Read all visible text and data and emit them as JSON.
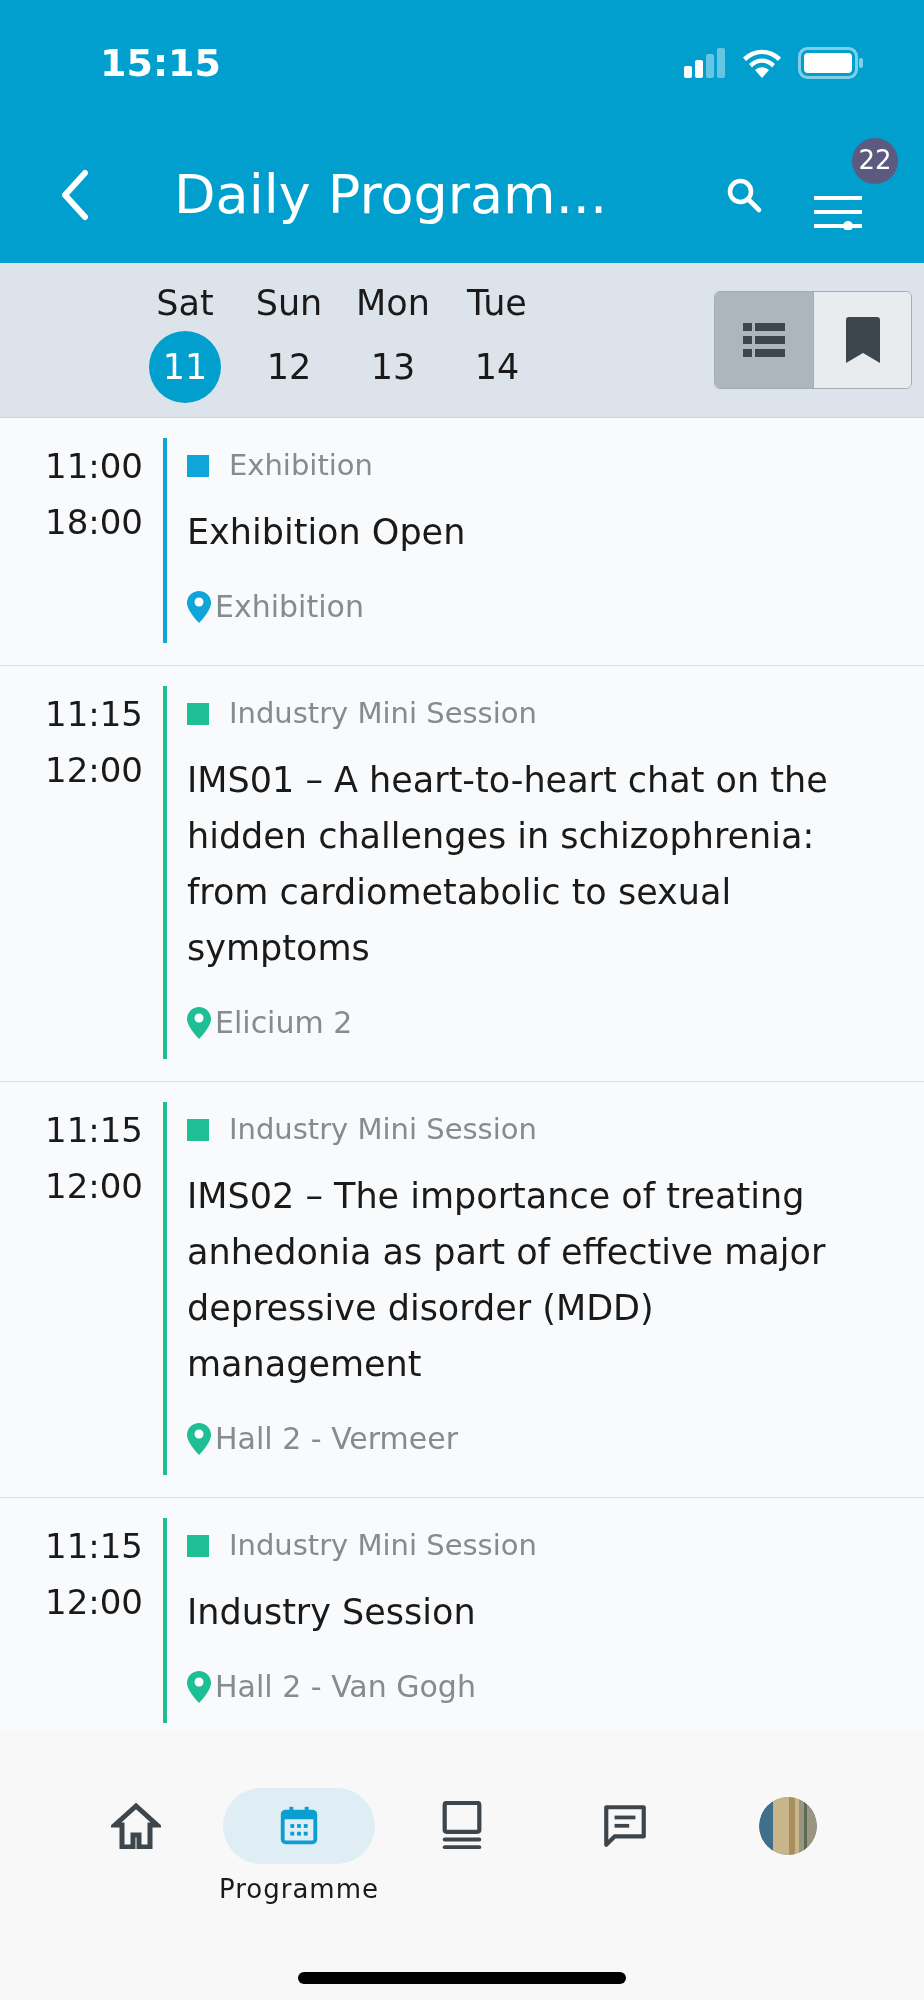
{
  "status_bar": {
    "time": "15:15"
  },
  "header": {
    "title": "Daily Program...",
    "filter_badge": "22"
  },
  "days": [
    {
      "weekday": "Sat",
      "date": "11",
      "selected": true
    },
    {
      "weekday": "Sun",
      "date": "12",
      "selected": false
    },
    {
      "weekday": "Mon",
      "date": "13",
      "selected": false
    },
    {
      "weekday": "Tue",
      "date": "14",
      "selected": false
    }
  ],
  "view_toggle": [
    {
      "kind": "list",
      "selected": true
    },
    {
      "kind": "bookmark",
      "selected": false
    }
  ],
  "sessions": [
    {
      "start": "11:00",
      "end": "18:00",
      "category": "Exhibition",
      "color": "#0fa5d8",
      "title": "Exhibition Open",
      "location": "Exhibition"
    },
    {
      "start": "11:15",
      "end": "12:00",
      "category": "Industry Mini Session",
      "color": "#1fbf95",
      "title": "IMS01 – A heart-to-heart chat on the hidden challenges in schizophrenia: from cardiometabolic to sexual symptoms",
      "location": "Elicium 2"
    },
    {
      "start": "11:15",
      "end": "12:00",
      "category": "Industry Mini Session",
      "color": "#1fbf95",
      "title": "IMS02 – The importance of treating anhedonia as part of effective major depressive disorder (MDD) management",
      "location": "Hall 2 - Vermeer"
    },
    {
      "start": "11:15",
      "end": "12:00",
      "category": "Industry Mini Session",
      "color": "#1fbf95",
      "title": "Industry Session",
      "location": "Hall 2 - Van Gogh"
    }
  ],
  "nav": [
    {
      "kind": "home",
      "selected": false
    },
    {
      "kind": "calendar",
      "label": "Programme",
      "selected": true
    },
    {
      "kind": "laptop",
      "selected": false
    },
    {
      "kind": "chat",
      "selected": false
    },
    {
      "kind": "avatar",
      "selected": false
    }
  ]
}
